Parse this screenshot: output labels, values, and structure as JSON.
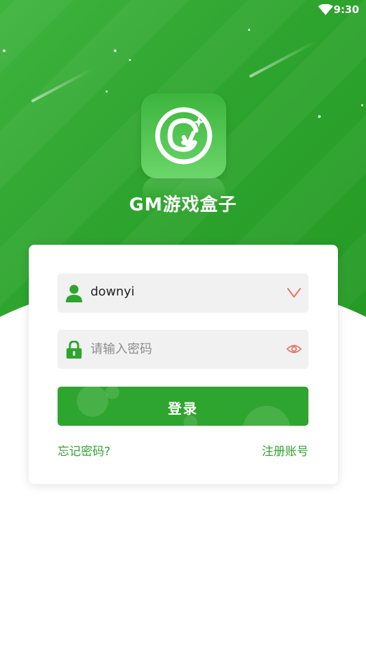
{
  "status_bar": {
    "time": "9:30",
    "wifi_icon": "wifi-icon"
  },
  "app": {
    "name": "GM游戏盒子",
    "logo_icon": "gm-logo-icon"
  },
  "login_form": {
    "username": {
      "value": "downyi",
      "lead_icon": "user-icon",
      "trail_icon": "chevron-down-icon"
    },
    "password": {
      "placeholder": "请输入密码",
      "lead_icon": "lock-icon",
      "trail_icon": "eye-icon"
    },
    "submit_label": "登录",
    "forgot_link": "忘记密码?",
    "register_link": "注册账号"
  },
  "colors": {
    "brand_green": "#2ea52e",
    "accent_red": "#e8736a",
    "field_bg": "#f1f1f1"
  }
}
